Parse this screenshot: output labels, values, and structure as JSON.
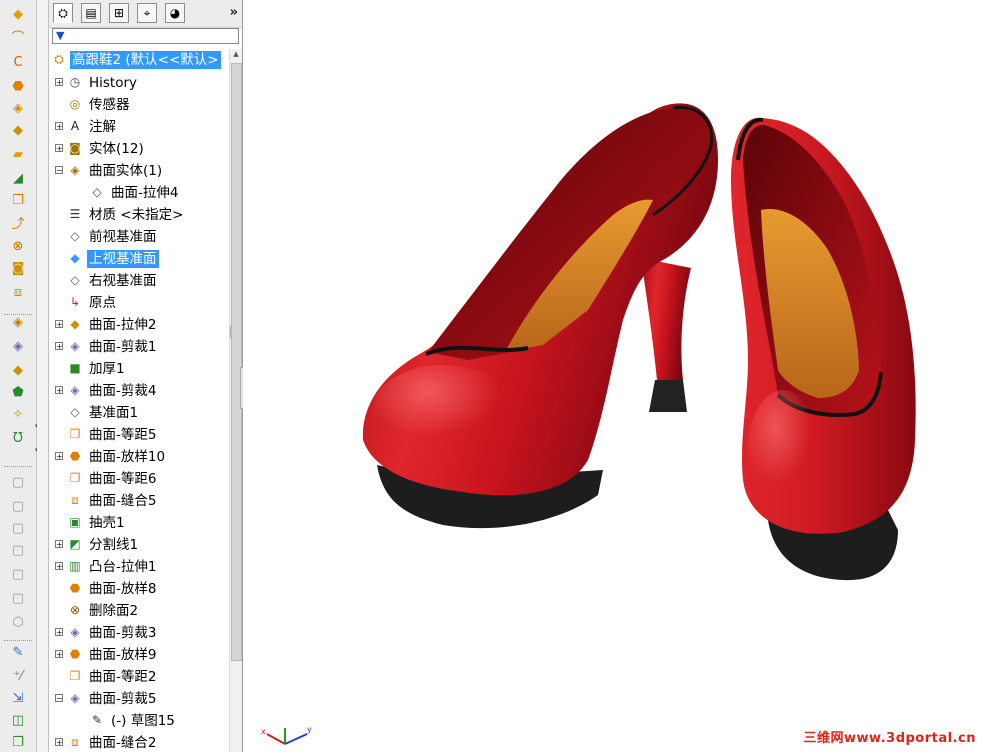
{
  "app": {
    "name": "SolidWorks FeatureManager"
  },
  "panel_tabs": [
    {
      "name": "featuremanager-tab",
      "icon": "featuremanager-tree-icon",
      "glyph": "⛭",
      "active": true
    },
    {
      "name": "propertymanager-tab",
      "icon": "propertymanager-icon",
      "glyph": "▤",
      "active": false
    },
    {
      "name": "configurationmanager-tab",
      "icon": "configurationmanager-icon",
      "glyph": "⊞",
      "active": false
    },
    {
      "name": "dimxpert-tab",
      "icon": "dimxpert-icon",
      "glyph": "⌖",
      "active": false
    },
    {
      "name": "display-manager-tab",
      "icon": "display-manager-icon",
      "glyph": "◕",
      "active": false
    }
  ],
  "more_glyph": "»",
  "filter": {
    "icon": "filter-icon",
    "glyph": "▼",
    "value": ""
  },
  "tree": {
    "root_label": "高跟鞋2 (默认<<默认>",
    "root_icon": "part-icon",
    "items": [
      {
        "label": "History",
        "icon": "history-icon",
        "glyph": "◷",
        "expander": "+",
        "indent": 0
      },
      {
        "label": "传感器",
        "icon": "sensor-icon",
        "glyph": "◎",
        "expander": "",
        "indent": 0
      },
      {
        "label": "注解",
        "icon": "annotation-icon",
        "glyph": "A",
        "expander": "+",
        "indent": 0
      },
      {
        "label": "实体(12)",
        "icon": "solid-bodies-icon",
        "glyph": "◙",
        "expander": "+",
        "indent": 0
      },
      {
        "label": "曲面实体(1)",
        "icon": "surface-bodies-icon",
        "glyph": "◈",
        "expander": "−",
        "indent": 0
      },
      {
        "label": "曲面-拉伸4",
        "icon": "surface-body-icon",
        "glyph": "◇",
        "expander": "",
        "indent": 1
      },
      {
        "label": "材质 <未指定>",
        "icon": "material-icon",
        "glyph": "☰",
        "expander": "",
        "indent": 0
      },
      {
        "label": "前视基准面",
        "icon": "plane-icon",
        "glyph": "◇",
        "expander": "",
        "indent": 0
      },
      {
        "label": "上视基准面",
        "icon": "plane-icon",
        "glyph": "◆",
        "expander": "",
        "indent": 0,
        "selected": true
      },
      {
        "label": "右视基准面",
        "icon": "plane-icon",
        "glyph": "◇",
        "expander": "",
        "indent": 0
      },
      {
        "label": "原点",
        "icon": "origin-icon",
        "glyph": "↳",
        "expander": "",
        "indent": 0
      },
      {
        "label": "曲面-拉伸2",
        "icon": "surface-extrude-icon",
        "glyph": "◆",
        "expander": "+",
        "indent": 0
      },
      {
        "label": "曲面-剪裁1",
        "icon": "surface-trim-icon",
        "glyph": "◈",
        "expander": "+",
        "indent": 0
      },
      {
        "label": "加厚1",
        "icon": "thicken-icon",
        "glyph": "■",
        "expander": "",
        "indent": 0
      },
      {
        "label": "曲面-剪裁4",
        "icon": "surface-trim-icon",
        "glyph": "◈",
        "expander": "+",
        "indent": 0
      },
      {
        "label": "基准面1",
        "icon": "plane-icon",
        "glyph": "◇",
        "expander": "",
        "indent": 0
      },
      {
        "label": "曲面-等距5",
        "icon": "surface-offset-icon",
        "glyph": "❐",
        "expander": "",
        "indent": 0
      },
      {
        "label": "曲面-放样10",
        "icon": "surface-loft-icon",
        "glyph": "⬣",
        "expander": "+",
        "indent": 0
      },
      {
        "label": "曲面-等距6",
        "icon": "surface-offset-icon",
        "glyph": "❐",
        "expander": "",
        "indent": 0
      },
      {
        "label": "曲面-缝合5",
        "icon": "surface-knit-icon",
        "glyph": "⧈",
        "expander": "",
        "indent": 0
      },
      {
        "label": "抽壳1",
        "icon": "shell-icon",
        "glyph": "▣",
        "expander": "",
        "indent": 0
      },
      {
        "label": "分割线1",
        "icon": "split-line-icon",
        "glyph": "◩",
        "expander": "+",
        "indent": 0
      },
      {
        "label": "凸台-拉伸1",
        "icon": "boss-extrude-icon",
        "glyph": "▥",
        "expander": "+",
        "indent": 0
      },
      {
        "label": "曲面-放样8",
        "icon": "surface-loft-icon",
        "glyph": "⬣",
        "expander": "",
        "indent": 0
      },
      {
        "label": "删除面2",
        "icon": "delete-face-icon",
        "glyph": "⊗",
        "expander": "",
        "indent": 0
      },
      {
        "label": "曲面-剪裁3",
        "icon": "surface-trim-icon",
        "glyph": "◈",
        "expander": "+",
        "indent": 0
      },
      {
        "label": "曲面-放样9",
        "icon": "surface-loft-icon",
        "glyph": "⬣",
        "expander": "+",
        "indent": 0
      },
      {
        "label": "曲面-等距2",
        "icon": "surface-offset-icon",
        "glyph": "❐",
        "expander": "",
        "indent": 0
      },
      {
        "label": "曲面-剪裁5",
        "icon": "surface-trim-icon",
        "glyph": "◈",
        "expander": "−",
        "indent": 0
      },
      {
        "label": "(-) 草图15",
        "icon": "sketch-icon",
        "glyph": "✎",
        "expander": "",
        "indent": 1
      },
      {
        "label": "曲面-缝合2",
        "icon": "surface-knit-icon",
        "glyph": "⧈",
        "expander": "+",
        "indent": 0
      }
    ]
  },
  "command_toolbar": [
    {
      "name": "extruded-surface-icon",
      "glyph": "◆",
      "color": "#e0a000",
      "dim": false
    },
    {
      "name": "revolved-surface-icon",
      "glyph": "⌒",
      "color": "#d08000",
      "dim": false
    },
    {
      "name": "swept-surface-icon",
      "glyph": "C",
      "color": "#d06000",
      "dim": false
    },
    {
      "name": "lofted-surface-icon",
      "glyph": "⬣",
      "color": "#e08000",
      "dim": false
    },
    {
      "name": "boundary-surface-icon",
      "glyph": "◈",
      "color": "#d09000",
      "dim": false
    },
    {
      "name": "offset-surface-icon",
      "glyph": "◆",
      "color": "#d09000",
      "dim": false
    },
    {
      "name": "planar-surface-icon",
      "glyph": "▰",
      "color": "#e0a000",
      "dim": false
    },
    {
      "name": "fill-surface-icon",
      "glyph": "◢",
      "color": "#2a8a2a",
      "dim": false
    },
    {
      "name": "knit-surface-icon",
      "glyph": "❐",
      "color": "#d08000",
      "dim": false
    },
    {
      "name": "extend-surface-icon",
      "glyph": "⤴",
      "color": "#d08000",
      "dim": false
    },
    {
      "name": "delete-face-icon",
      "glyph": "⊗",
      "color": "#c07000",
      "dim": false
    },
    {
      "name": "untrim-surface-icon",
      "glyph": "◙",
      "color": "#d09000",
      "dim": false
    },
    {
      "name": "thicken-icon",
      "glyph": "⧈",
      "color": "#d09000",
      "dim": false
    },
    {
      "name": "trim-surface-icon",
      "glyph": "◈",
      "color": "#c08000",
      "dim": false
    },
    {
      "name": "ruled-surface-icon",
      "glyph": "◈",
      "color": "#6a6ab0",
      "dim": false
    },
    {
      "name": "cut-with-surface-icon",
      "glyph": "◆",
      "color": "#d09000",
      "dim": false
    },
    {
      "name": "replace-face-icon",
      "glyph": "⬟",
      "color": "#2a8a2a",
      "dim": false
    },
    {
      "name": "curves-icon",
      "glyph": "✧",
      "color": "#c0a000",
      "dim": false
    },
    {
      "name": "reference-geometry-icon",
      "glyph": "Ʊ",
      "color": "#2a8a2a",
      "dim": false
    },
    {
      "name": "view-iso-icon",
      "glyph": "▢",
      "color": "#9a9a9a",
      "dim": true
    },
    {
      "name": "view-front-icon",
      "glyph": "▢",
      "color": "#9a9a9a",
      "dim": true
    },
    {
      "name": "view-top-icon",
      "glyph": "▢",
      "color": "#9a9a9a",
      "dim": true
    },
    {
      "name": "view-right-icon",
      "glyph": "▢",
      "color": "#9a9a9a",
      "dim": true
    },
    {
      "name": "view-back-icon",
      "glyph": "▢",
      "color": "#9a9a9a",
      "dim": true
    },
    {
      "name": "view-bottom-icon",
      "glyph": "▢",
      "color": "#9a9a9a",
      "dim": true
    },
    {
      "name": "view-normal-icon",
      "glyph": "⬡",
      "color": "#9a9a9a",
      "dim": true
    },
    {
      "name": "sketch-icon",
      "glyph": "✎",
      "color": "#3a6ad0",
      "dim": false
    },
    {
      "name": "smart-dimension-icon",
      "glyph": "⁺⁄",
      "color": "#777777",
      "dim": false
    },
    {
      "name": "move-entities-icon",
      "glyph": "⇲",
      "color": "#2a6ad0",
      "dim": false
    },
    {
      "name": "convert-entities-icon",
      "glyph": "◫",
      "color": "#2a8a2a",
      "dim": false
    },
    {
      "name": "offset-entities-icon",
      "glyph": "❐",
      "color": "#2a8a2a",
      "dim": false
    }
  ],
  "watermark": "三维网www.3dportal.cn",
  "colors": {
    "shoe_red": "#c8141e",
    "sole_black": "#1a1a1a",
    "insole_orange": "#d8861e",
    "selection": "#3399ff"
  }
}
